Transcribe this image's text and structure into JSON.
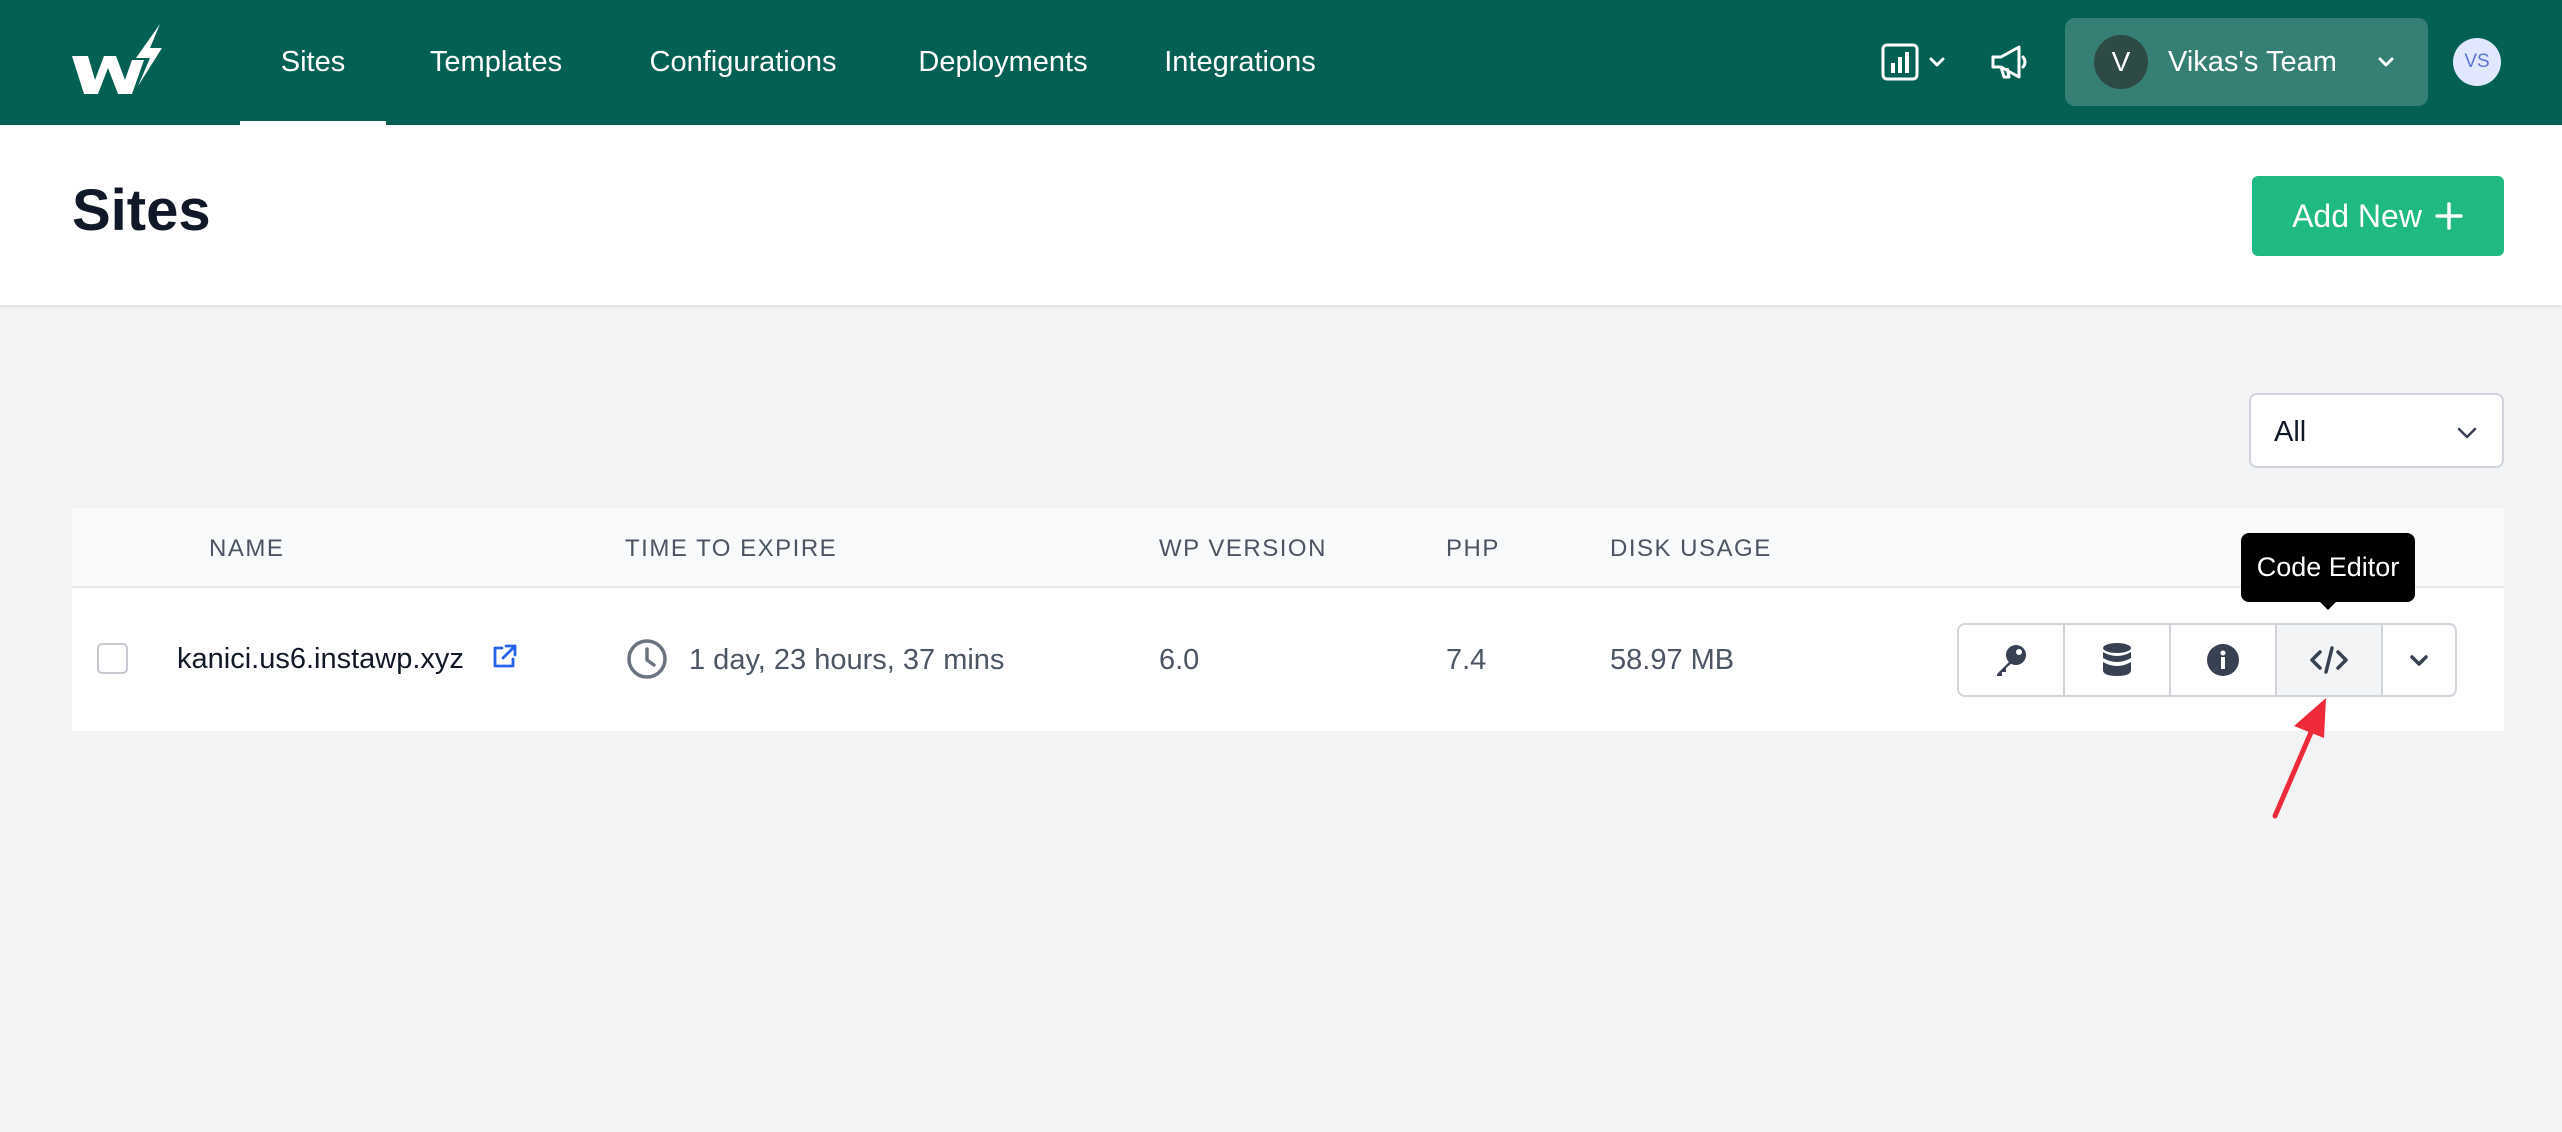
{
  "nav": {
    "tabs": [
      {
        "label": "Sites",
        "active": true
      },
      {
        "label": "Templates"
      },
      {
        "label": "Configurations"
      },
      {
        "label": "Deployments"
      },
      {
        "label": "Integrations"
      }
    ],
    "team": {
      "avatar_letter": "V",
      "name": "Vikas's Team"
    },
    "user_initials": "VS",
    "icons": [
      "analytics-icon",
      "megaphone-icon"
    ]
  },
  "header": {
    "title": "Sites",
    "add_button_label": "Add New"
  },
  "filter": {
    "selected": "All"
  },
  "table": {
    "columns": [
      "NAME",
      "TIME TO EXPIRE",
      "WP VERSION",
      "PHP",
      "DISK USAGE"
    ],
    "rows": [
      {
        "name": "kanici.us6.instawp.xyz",
        "time_to_expire": "1 day, 23 hours, 37 mins",
        "wp_version": "6.0",
        "php": "7.4",
        "disk_usage": "58.97 MB"
      }
    ],
    "actions": [
      "key-icon",
      "database-icon",
      "info-icon",
      "code-icon",
      "chevron-down-icon"
    ]
  },
  "tooltip": {
    "text": "Code Editor"
  },
  "colors": {
    "nav_bg": "#046052",
    "add_button": "#1fba82",
    "arrow": "#ef2b3a"
  }
}
